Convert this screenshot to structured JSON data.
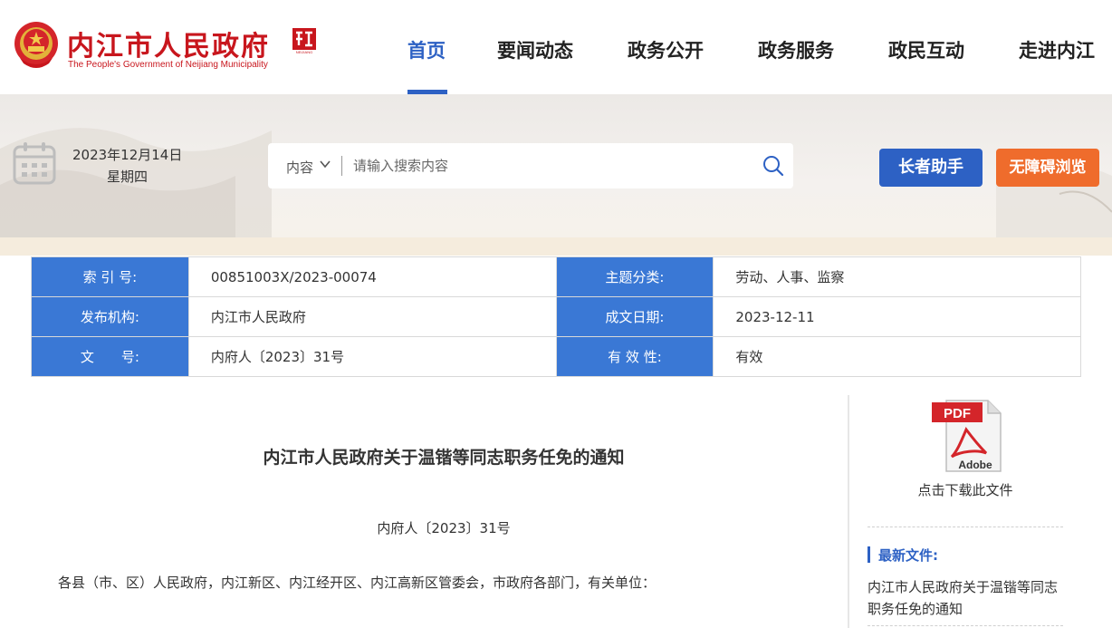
{
  "header": {
    "site_title": "内江市人民政府",
    "site_subtitle": "The People's Government of Neijiang Municipality",
    "nav": [
      {
        "label": "首页",
        "active": true
      },
      {
        "label": "要闻动态"
      },
      {
        "label": "政务公开"
      },
      {
        "label": "政务服务"
      },
      {
        "label": "政民互动"
      },
      {
        "label": "走进内江"
      }
    ],
    "accent_color": "#2d61c4",
    "brand_color": "#c8161d"
  },
  "banner": {
    "date": "2023年12月14日",
    "weekday": "星期四",
    "calendar_icon": "calendar-icon"
  },
  "search": {
    "scope": "内容",
    "placeholder": "请输入搜索内容",
    "icon": "search-icon"
  },
  "buttons": {
    "elder": "长者助手",
    "accessible": "无障碍浏览",
    "elder_color": "#2d61c4",
    "accessible_color": "#ef6c2c"
  },
  "meta": {
    "index_no_label": "索 引 号:",
    "index_no": "00851003X/2023-00074",
    "topic_label": "主题分类:",
    "topic": "劳动、人事、监察",
    "publisher_label": "发布机构:",
    "publisher": "内江市人民政府",
    "date_label": "成文日期:",
    "date": "2023-12-11",
    "doc_no_label": "文　　号:",
    "doc_no": "内府人〔2023〕31号",
    "validity_label": "有 效 性:",
    "validity": "有效"
  },
  "article": {
    "title": "内江市人民政府关于温锴等同志职务任免的通知",
    "doc_no": "内府人〔2023〕31号",
    "first_para": "各县（市、区）人民政府，内江新区、内江经开区、内江高新区管委会，市政府各部门，有关单位："
  },
  "sidebar": {
    "pdf_badge": "PDF",
    "pdf_brand": "Adobe",
    "download_text": "点击下载此文件",
    "latest_label": "最新文件:",
    "latest_items": [
      "内江市人民政府关于温锴等同志职务任免的通知"
    ]
  }
}
